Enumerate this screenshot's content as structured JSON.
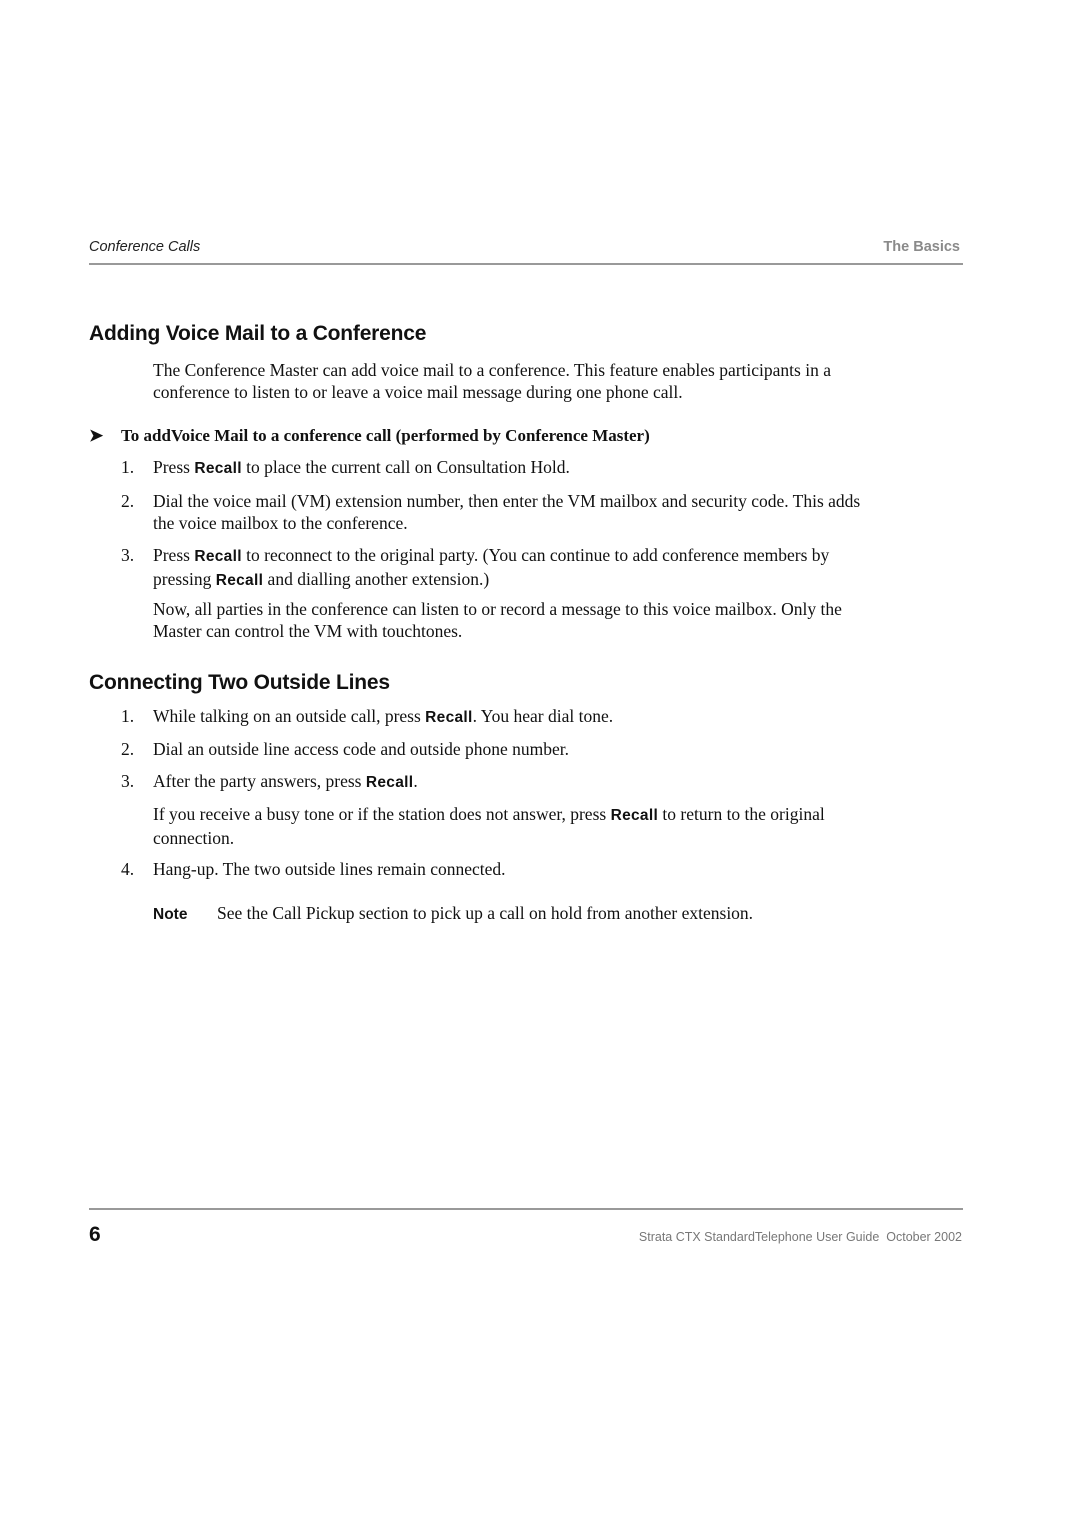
{
  "header": {
    "left": "Conference Calls",
    "right": "The Basics"
  },
  "section1": {
    "title": "Adding Voice Mail to a Conference",
    "intro_line1": "The Conference Master can add voice mail to a conference. This feature enables participants in a",
    "intro_line2": "conference to listen to or leave a voice mail message during one phone call.",
    "procedure_arrow": "➤",
    "procedure_title": "To addVoice Mail to a conference call (performed by Conference Master)",
    "steps": [
      {
        "num": "1.",
        "a": "Press ",
        "key": "Recall",
        "b": " to place the current call on Consultation Hold."
      },
      {
        "num": "2.",
        "line1": "Dial the voice mail (VM) extension number, then enter the VM mailbox and security code. This adds",
        "line2": "the voice mailbox to the conference."
      },
      {
        "num": "3.",
        "a": "Press ",
        "key": "Recall",
        "b": " to reconnect to the original party. (You can continue to add conference members by",
        "c": "pressing ",
        "key2": "Recall",
        "d": " and dialling another extension.)"
      }
    ],
    "after_line1": "Now, all parties in the conference can listen to or record a message to this voice mailbox. Only the",
    "after_line2": "Master can control the VM with touchtones."
  },
  "section2": {
    "title": "Connecting Two Outside Lines",
    "steps": [
      {
        "num": "1.",
        "a": "While talking on an outside call, press ",
        "key": "Recall",
        "b": ". You hear dial tone."
      },
      {
        "num": "2.",
        "text": "Dial an outside line access code and outside phone number."
      },
      {
        "num": "3.",
        "a": "After the party answers, press ",
        "key": "Recall",
        "b": "."
      },
      {
        "num": "4.",
        "text": "Hang-up. The two outside lines remain connected."
      }
    ],
    "busy_a": "If you receive a busy tone or if the station does not answer, press ",
    "busy_key": "Recall",
    "busy_b": " to return to the original",
    "busy_line2": "connection.",
    "note_label": "Note",
    "note_text": "See the Call Pickup section to pick up a call on hold from another extension."
  },
  "footer": {
    "page_number": "6",
    "right": "Strata CTX StandardTelephone User Guide  October 2002"
  }
}
